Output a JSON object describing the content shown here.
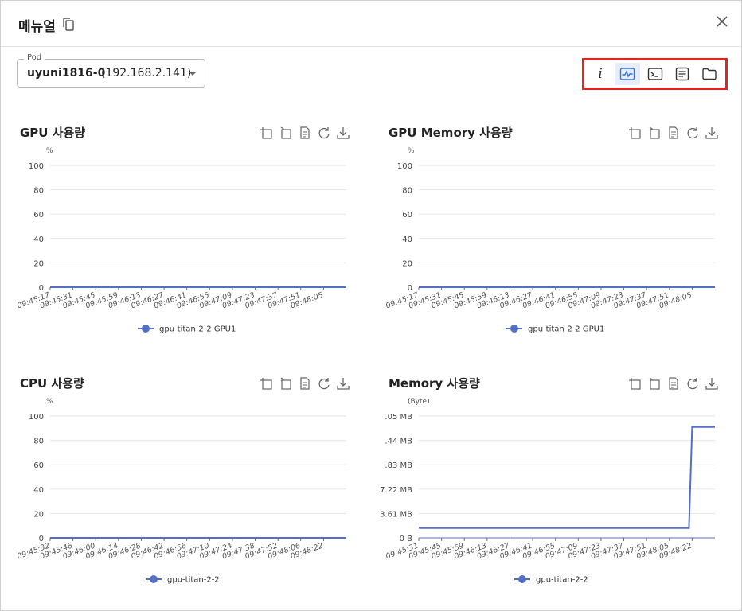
{
  "dialog": {
    "title": "메뉴얼"
  },
  "pod": {
    "label": "Pod",
    "name": "uyuni1816-0",
    "ip": "(192.168.2.141)"
  },
  "toolbar": {
    "buttons": [
      "info-icon",
      "monitor-icon",
      "terminal-icon",
      "log-icon",
      "folder-icon"
    ],
    "active": "monitor-icon",
    "info_glyph": "i"
  },
  "colors": {
    "series": "#5470c6",
    "highlight": "#e8231f",
    "active_bg": "#e6eefb"
  },
  "chart_tools": [
    "zoom-icon",
    "zoom-reset-icon",
    "data-view-icon",
    "restore-icon",
    "save-image-icon"
  ],
  "chart_data": [
    {
      "type": "line",
      "title": "GPU 사용량",
      "ylabel": "%",
      "yticks": [
        "100",
        "80",
        "60",
        "40",
        "20",
        "0"
      ],
      "ylim": [
        0,
        100
      ],
      "x": [
        "09:45:17",
        "09:45:31",
        "09:45:45",
        "09:45:59",
        "09:46:13",
        "09:46:27",
        "09:46:41",
        "09:46:55",
        "09:47:09",
        "09:47:23",
        "09:47:37",
        "09:47:51",
        "09:48:05"
      ],
      "series": [
        {
          "name": "gpu-titan-2-2 GPU1",
          "values": [
            0,
            0,
            0,
            0,
            0,
            0,
            0,
            0,
            0,
            0,
            0,
            0,
            0,
            0
          ]
        }
      ],
      "grid": true,
      "legend": "bottom"
    },
    {
      "type": "line",
      "title": "GPU Memory 사용량",
      "ylabel": "%",
      "yticks": [
        "100",
        "80",
        "60",
        "40",
        "20",
        "0"
      ],
      "ylim": [
        0,
        100
      ],
      "x": [
        "09:45:17",
        "09:45:31",
        "09:45:45",
        "09:45:59",
        "09:46:13",
        "09:46:27",
        "09:46:41",
        "09:46:55",
        "09:47:09",
        "09:47:23",
        "09:47:37",
        "09:47:51",
        "09:48:05"
      ],
      "series": [
        {
          "name": "gpu-titan-2-2 GPU1",
          "values": [
            0,
            0,
            0,
            0,
            0,
            0,
            0,
            0,
            0,
            0,
            0,
            0,
            0,
            0
          ]
        }
      ],
      "grid": true,
      "legend": "bottom"
    },
    {
      "type": "line",
      "title": "CPU 사용량",
      "ylabel": "%",
      "yticks": [
        "100",
        "80",
        "60",
        "40",
        "20",
        "0"
      ],
      "ylim": [
        0,
        100
      ],
      "x": [
        "09:45:32",
        "09:45:46",
        "09:46:00",
        "09:46:14",
        "09:46:28",
        "09:46:42",
        "09:46:56",
        "09:47:10",
        "09:47:24",
        "09:47:38",
        "09:47:52",
        "09:48:06",
        "09:48:22"
      ],
      "series": [
        {
          "name": "gpu-titan-2-2",
          "values": [
            0,
            0,
            0,
            0,
            0,
            0,
            0,
            0,
            0,
            0,
            0,
            0,
            0,
            0
          ]
        }
      ],
      "grid": true,
      "legend": "bottom"
    },
    {
      "type": "line",
      "title": "Memory 사용량",
      "ylabel": "(Byte)",
      "yticks": [
        ".05 MB",
        ".44 MB",
        ".83 MB",
        "7.22 MB",
        "3.61 MB",
        "0 B"
      ],
      "ylim": [
        0,
        5
      ],
      "x": [
        "09:45:31",
        "09:45:45",
        "09:45:59",
        "09:46:13",
        "09:46:27",
        "09:46:41",
        "09:46:55",
        "09:47:09",
        "09:47:23",
        "09:47:37",
        "09:47:51",
        "09:48:05",
        "09:48:22"
      ],
      "series": [
        {
          "name": "gpu-titan-2-2",
          "values": [
            0.4,
            0.4,
            0.4,
            0.4,
            0.4,
            0.4,
            0.4,
            0.4,
            0.4,
            0.4,
            0.4,
            0.4,
            4.55,
            4.55
          ]
        }
      ],
      "grid": true,
      "legend": "bottom"
    }
  ]
}
